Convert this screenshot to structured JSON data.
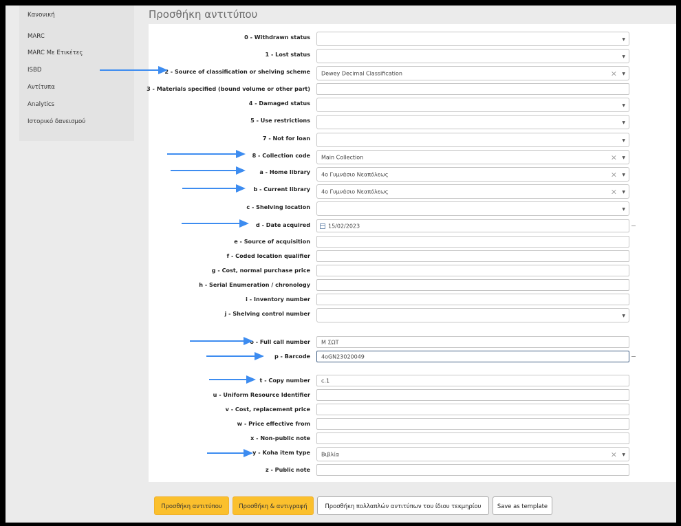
{
  "header": {
    "title": "Προσθήκη αντιτύπου"
  },
  "sidebar": {
    "items": [
      {
        "label": "Κανονική"
      },
      {
        "label": "MARC"
      },
      {
        "label": "MARC Με Ετικέτες"
      },
      {
        "label": "ISBD"
      },
      {
        "label": "Αντίτυπα"
      },
      {
        "label": "Analytics"
      },
      {
        "label": "Ιστορικό δανεισμού"
      }
    ]
  },
  "form": {
    "withdrawn_status": {
      "label": "0 - Withdrawn status",
      "value": ""
    },
    "lost_status": {
      "label": "1 - Lost status",
      "value": ""
    },
    "classification_source": {
      "label": "2 - Source of classification or shelving scheme",
      "value": "Dewey Decimal Classification"
    },
    "materials_specified": {
      "label": "3 - Materials specified (bound volume or other part)",
      "value": ""
    },
    "damaged_status": {
      "label": "4 - Damaged status",
      "value": ""
    },
    "use_restrictions": {
      "label": "5 - Use restrictions",
      "value": ""
    },
    "not_for_loan": {
      "label": "7 - Not for loan",
      "value": ""
    },
    "collection_code": {
      "label": "8 - Collection code",
      "value": "Main Collection"
    },
    "home_library": {
      "label": "a - Home library",
      "value": "4ο Γυμνάσιο Νεαπόλεως"
    },
    "current_library": {
      "label": "b - Current library",
      "value": "4ο Γυμνάσιο Νεαπόλεως"
    },
    "shelving_location": {
      "label": "c - Shelving location",
      "value": ""
    },
    "date_acquired": {
      "label": "d - Date acquired",
      "value": "15/02/2023"
    },
    "source_of_acquisition": {
      "label": "e - Source of acquisition",
      "value": ""
    },
    "coded_location_qualifier": {
      "label": "f - Coded location qualifier",
      "value": ""
    },
    "cost_normal_purchase": {
      "label": "g - Cost, normal purchase price",
      "value": ""
    },
    "serial_enumeration": {
      "label": "h - Serial Enumeration / chronology",
      "value": ""
    },
    "inventory_number": {
      "label": "i - Inventory number",
      "value": ""
    },
    "shelving_control_number": {
      "label": "j - Shelving control number",
      "value": ""
    },
    "full_call_number": {
      "label": "o - Full call number",
      "value": "Μ ΣΩΤ"
    },
    "barcode": {
      "label": "p - Barcode",
      "value": "4oGN23020049"
    },
    "copy_number": {
      "label": "t - Copy number",
      "value": "c.1"
    },
    "uri": {
      "label": "u - Uniform Resource Identifier",
      "value": ""
    },
    "cost_replacement": {
      "label": "v - Cost, replacement price",
      "value": ""
    },
    "price_effective_from": {
      "label": "w - Price effective from",
      "value": ""
    },
    "non_public_note": {
      "label": "x - Non-public note",
      "value": ""
    },
    "koha_item_type": {
      "label": "y - Koha item type",
      "value": "Βιβλία"
    },
    "public_note": {
      "label": "z - Public note",
      "value": ""
    }
  },
  "icons": {
    "clear": "×",
    "dropdown": "▼"
  },
  "buttons": {
    "add_item": "Προσθήκη αντιτύπου",
    "add_and_duplicate": "Προσθήκη & αντιγραφή",
    "add_multiple": "Προσθήκη πολλαπλών αντιτύπων του ίδιου τεκμηρίου",
    "save_as_template": "Save as template"
  },
  "colors": {
    "arrow": "#3d8cf0",
    "primary_button": "#fbc02d",
    "active_border": "#3e5d82"
  }
}
